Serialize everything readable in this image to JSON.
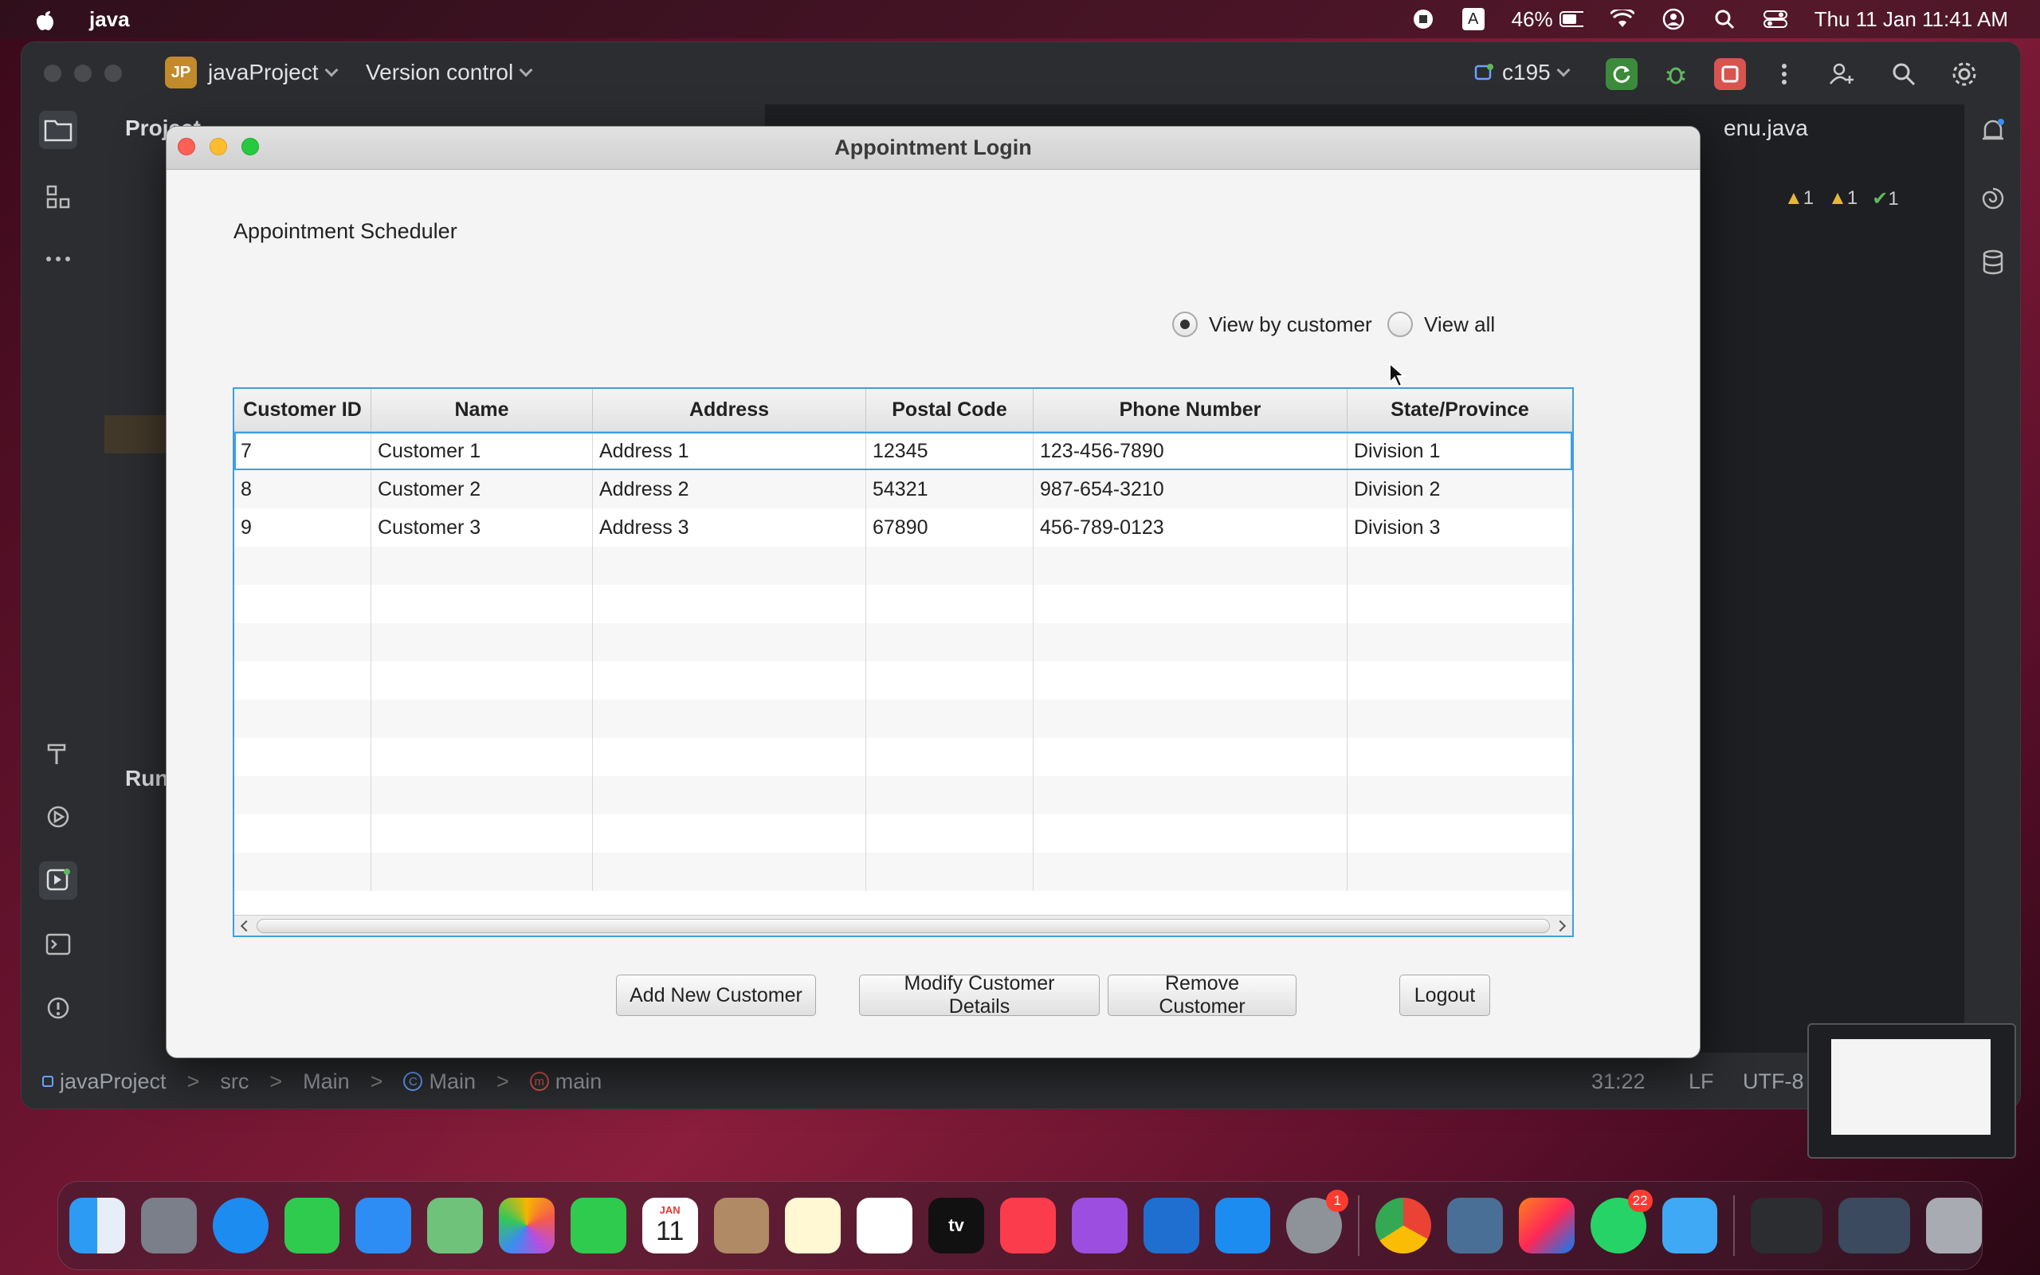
{
  "menubar": {
    "app_name": "java",
    "battery": "46%",
    "datetime": "Thu 11 Jan  11:41 AM",
    "input_source": "A"
  },
  "ide": {
    "project_badge": "JP",
    "project_name": "javaProject",
    "vcs": "Version control",
    "run_config": "c195",
    "panel_title": "Project",
    "tab_title": "enu.java",
    "run_label": "Run",
    "warnings": [
      "1",
      "1",
      "1"
    ]
  },
  "statusbar": {
    "breadcrumbs": [
      "javaProject",
      "src",
      "Main",
      "Main",
      "main"
    ],
    "position": "31:22",
    "line_sep": "LF",
    "encoding": "UTF-8"
  },
  "dialog": {
    "title": "Appointment Login",
    "heading": "Appointment Scheduler",
    "radio_by_customer": "View by customer",
    "radio_view_all": "View all",
    "selected_radio": "View by customer",
    "columns": [
      "Customer ID",
      "Name",
      "Address",
      "Postal Code",
      "Phone Number",
      "State/Province"
    ],
    "rows": [
      [
        "7",
        "Customer 1",
        "Address 1",
        "12345",
        "123-456-7890",
        "Division 1"
      ],
      [
        "8",
        "Customer 2",
        "Address 2",
        "54321",
        "987-654-3210",
        "Division 2"
      ],
      [
        "9",
        "Customer 3",
        "Address 3",
        "67890",
        "456-789-0123",
        "Division 3"
      ]
    ],
    "buttons": {
      "add": "Add New Customer",
      "modify": "Modify Customer Details",
      "remove": "Remove Customer",
      "logout": "Logout"
    }
  },
  "dock": {
    "calendar_month": "JAN",
    "calendar_day": "11",
    "settings_badge": "1",
    "whatsapp_badge": "22",
    "tv_label": "tv"
  },
  "colors": {
    "table_focus": "#3d9fe0",
    "close": "#fe5f57",
    "minimize": "#febc2e",
    "zoom": "#28c840"
  }
}
